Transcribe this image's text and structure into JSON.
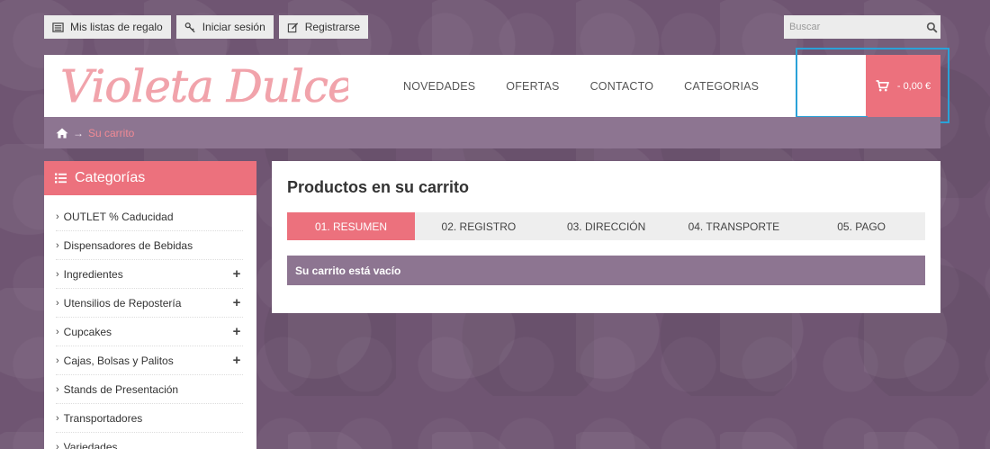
{
  "topbar": {
    "giftlists_label": "Mis listas de regalo",
    "login_label": "Iniciar sesión",
    "register_label": "Registrarse"
  },
  "search": {
    "placeholder": "Buscar"
  },
  "header": {
    "logo_text": "Violeta Dulce",
    "nav": [
      "NOVEDADES",
      "OFERTAS",
      "CONTACTO",
      "CATEGORIAS"
    ],
    "cart_label": "- 0,00 €"
  },
  "breadcrumb": {
    "arrow": "→",
    "current": "Su carrito"
  },
  "sidebar": {
    "title": "Categorías",
    "items": [
      {
        "label": "OUTLET % Caducidad",
        "expandable": false
      },
      {
        "label": "Dispensadores de Bebidas",
        "expandable": false
      },
      {
        "label": "Ingredientes",
        "expandable": true
      },
      {
        "label": "Utensilios de Repostería",
        "expandable": true
      },
      {
        "label": "Cupcakes",
        "expandable": true
      },
      {
        "label": "Cajas, Bolsas y Palitos",
        "expandable": true
      },
      {
        "label": "Stands de Presentación",
        "expandable": false
      },
      {
        "label": "Transportadores",
        "expandable": false
      },
      {
        "label": "Variedades",
        "expandable": false
      }
    ]
  },
  "main": {
    "title": "Productos en su carrito",
    "steps": [
      "01. RESUMEN",
      "02. REGISTRO",
      "03. DIRECCIÓN",
      "04. TRANSPORTE",
      "05. PAGO"
    ],
    "active_step": 0,
    "empty_message": "Su carrito está vacío"
  },
  "colors": {
    "accent": "#ec717d",
    "purple_bar": "#8d7591",
    "background": "#6f5572",
    "focus_outline": "#2aa2d8"
  },
  "icons": {
    "giftlist": "list-icon",
    "login": "key-icon",
    "register": "edit-icon",
    "search": "search-icon",
    "cart": "cart-icon",
    "home": "home-icon",
    "categories": "list-icon"
  }
}
